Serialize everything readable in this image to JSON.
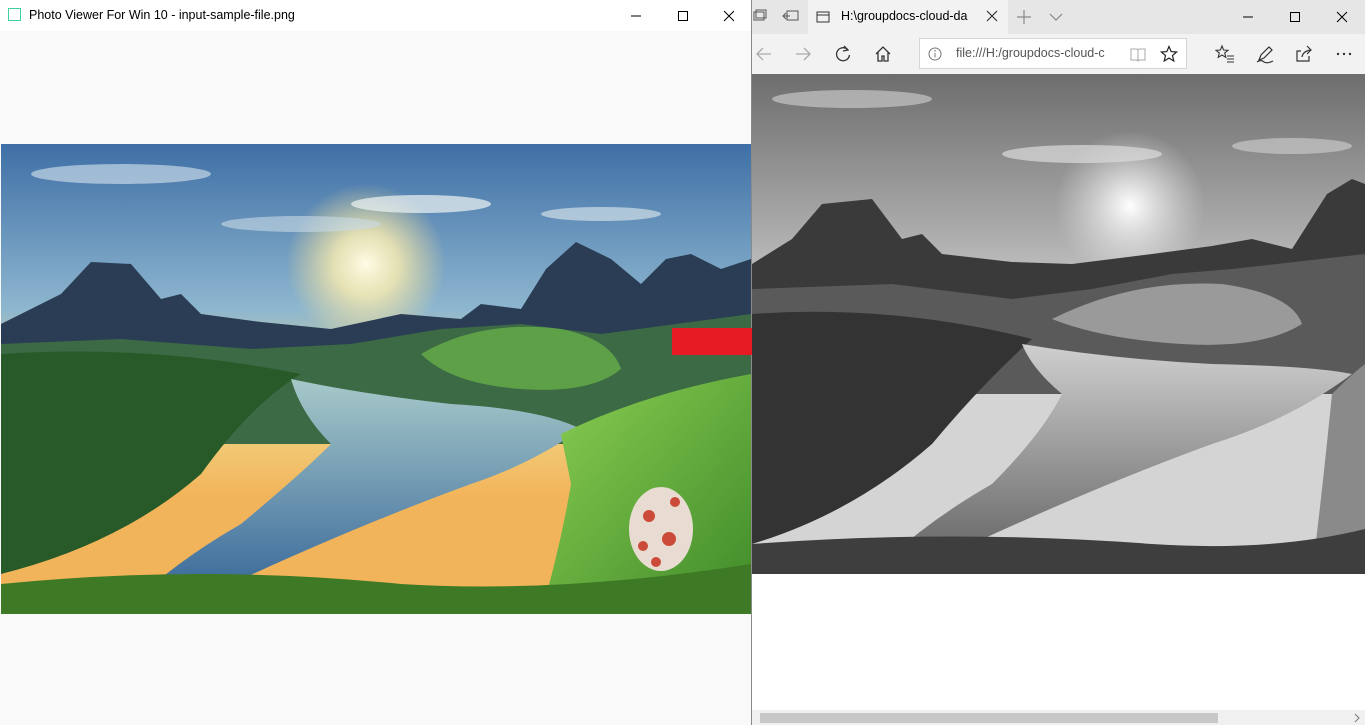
{
  "photo_viewer": {
    "title": "Photo Viewer For Win 10 - input-sample-file.png",
    "icons": {
      "app": "photo-viewer-app-icon",
      "minimize": "minimize-icon",
      "maximize": "maximize-icon",
      "close": "close-icon"
    }
  },
  "browser": {
    "tab_title": "H:\\groupdocs-cloud-da",
    "address": "file:///H:/groupdocs-cloud-c",
    "icons": {
      "set_aside": "set-tabs-aside-icon",
      "tabs_aside": "tabs-aside-icon",
      "tab_page": "page-icon",
      "tab_close": "close-icon",
      "new_tab": "plus-icon",
      "tab_list": "chevron-down-icon",
      "back": "back-arrow-icon",
      "forward": "forward-arrow-icon",
      "refresh": "refresh-icon",
      "home": "home-icon",
      "site_info": "info-icon",
      "reading_view": "book-icon",
      "favorite": "star-icon",
      "hub": "favorites-hub-icon",
      "notes": "pen-icon",
      "share": "share-icon",
      "more": "ellipsis-icon"
    }
  },
  "colors": {
    "arrow": "#e61b23",
    "titlebar": "#e6e6e6",
    "toolbar": "#f2f2f2",
    "viewer_bg": "#f9f9f9"
  }
}
